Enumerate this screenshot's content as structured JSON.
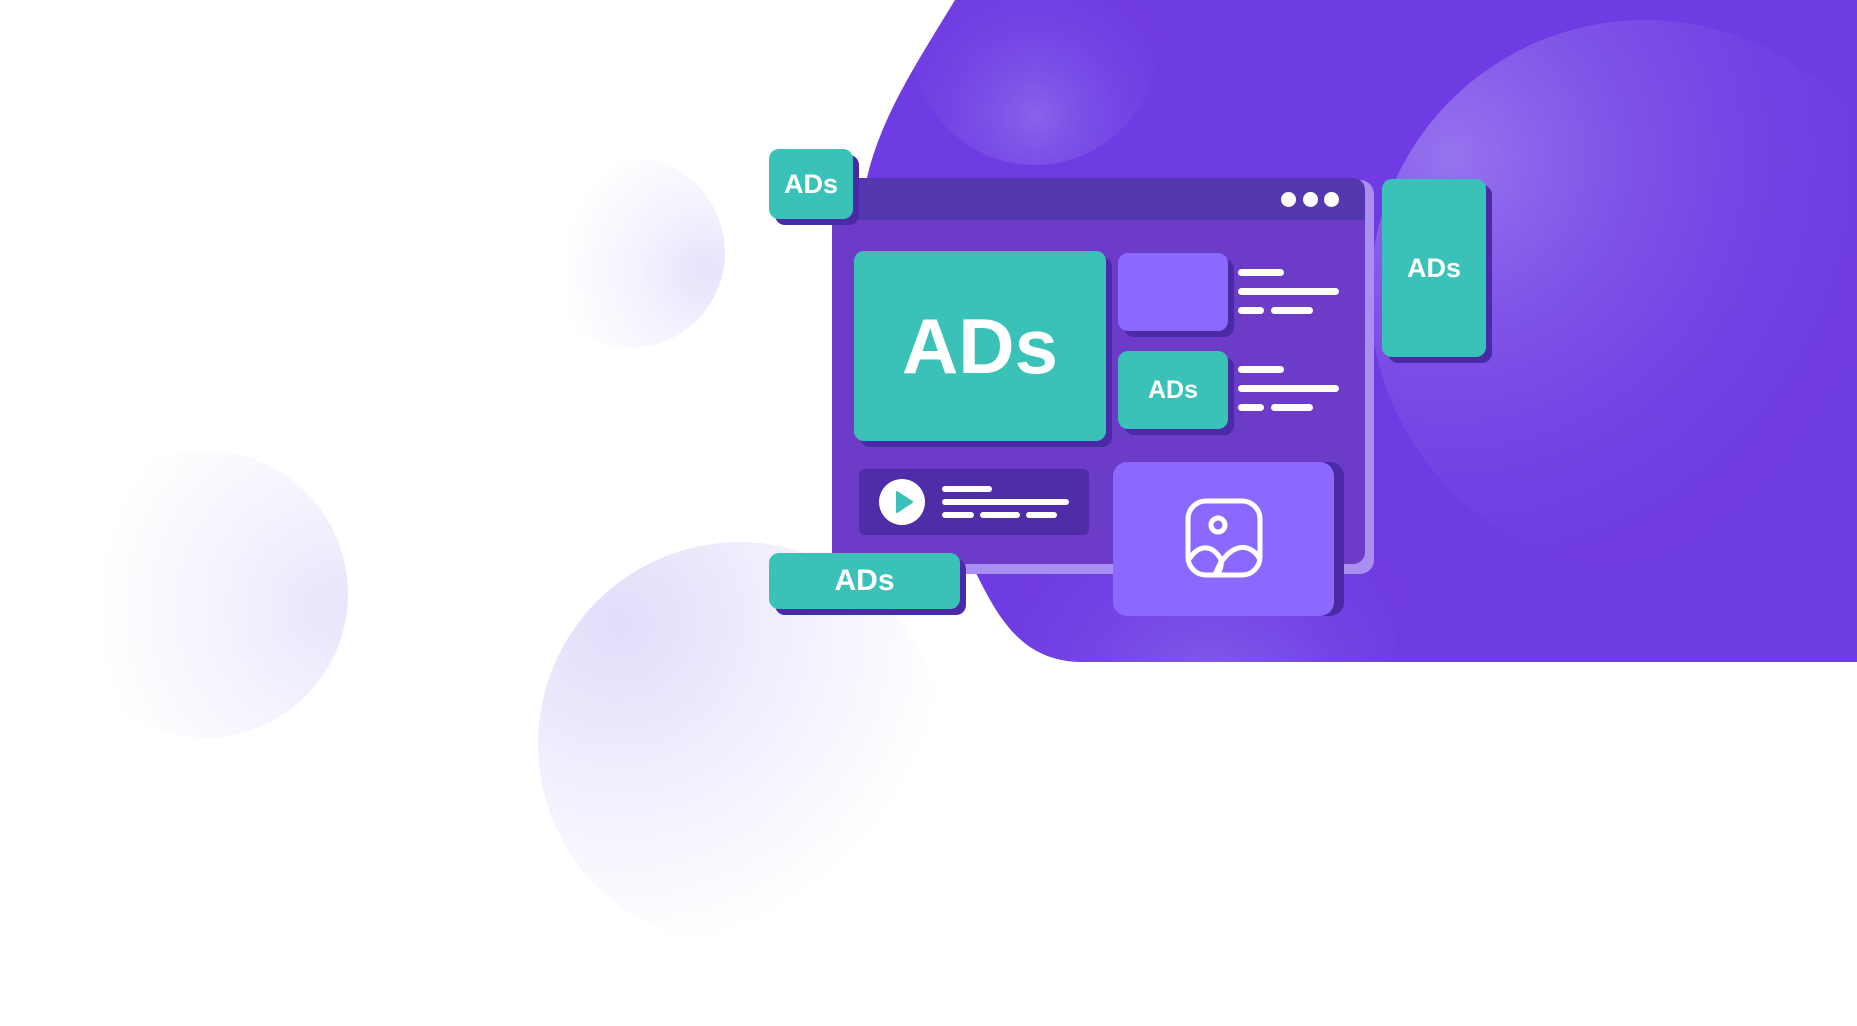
{
  "ads": {
    "top_left_tag": "ADs",
    "main_banner": "ADs",
    "small_tile": "ADs",
    "right_skyscraper": "ADs",
    "bottom_tag": "ADs"
  },
  "colors": {
    "purple_background": "#6f3be2",
    "window_body": "#6c3bc8",
    "window_bar": "#5538b0",
    "teal_ad": "#3ac2b8",
    "violet_tile": "#8c69fe",
    "shadow": "#4a2aa6"
  },
  "icons": {
    "window_controls": "three-dots-icon",
    "media": "play-icon",
    "image": "image-icon"
  }
}
